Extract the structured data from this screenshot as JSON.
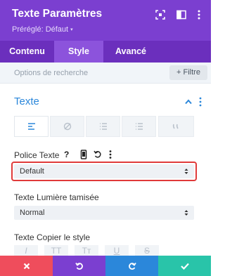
{
  "header": {
    "title": "Texte Paramètres",
    "subtitle": "Préréglé: Défaut",
    "subtitle_caret": "▾",
    "bg_color": "#7b3fd0"
  },
  "tabs": [
    {
      "label": "Contenu",
      "active": false
    },
    {
      "label": "Style",
      "active": true
    },
    {
      "label": "Avancé",
      "active": false
    }
  ],
  "search": {
    "placeholder": "Options de recherche",
    "filter_label": "+ Filtre"
  },
  "section": {
    "title": "Texte",
    "accent_color": "#2b87da"
  },
  "alignment": {
    "buttons": [
      "align-left-icon",
      "align-none-icon",
      "list-bullets-icon",
      "list-numbers-icon",
      "quote-icon"
    ],
    "active_index": 0
  },
  "fields": {
    "police": {
      "label": "Police Texte",
      "help": "?",
      "value": "Default"
    },
    "lumiere": {
      "label": "Texte Lumière tamisée",
      "value": "Normal"
    },
    "copier": {
      "label": "Texte Copier le style"
    }
  },
  "style_buttons": [
    "I",
    "TT",
    "Tт",
    "U",
    "S"
  ],
  "footer": {
    "buttons": [
      {
        "name": "cancel",
        "color": "#ef4d5c"
      },
      {
        "name": "undo",
        "color": "#7b3fd0"
      },
      {
        "name": "redo",
        "color": "#2b87da"
      },
      {
        "name": "save",
        "color": "#29c4a9"
      }
    ]
  },
  "highlight_color": "#e03a3a"
}
